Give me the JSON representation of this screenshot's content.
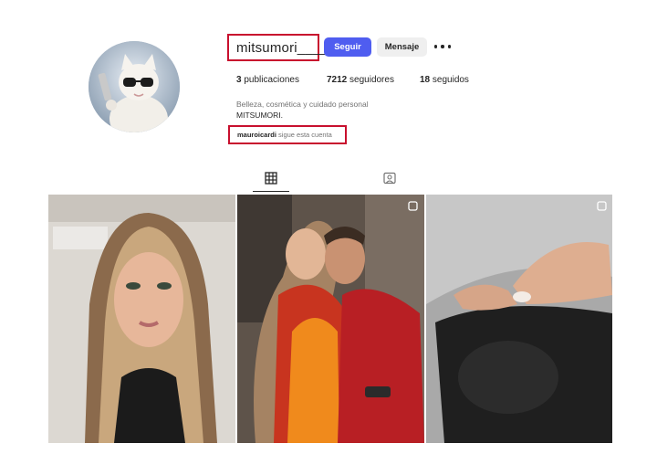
{
  "profile": {
    "username": "mitsumori____",
    "follow_label": "Seguir",
    "message_label": "Mensaje",
    "more_icon": "more-horizontal-icon"
  },
  "stats": {
    "posts_count": "3",
    "posts_label": "publicaciones",
    "followers_count": "7212",
    "followers_label": "seguidores",
    "following_count": "18",
    "following_label": "seguidos"
  },
  "bio": {
    "category": "Belleza, cosmética y cuidado personal",
    "name": "MITSUMORI."
  },
  "followed_by": {
    "user": "mauroicardi",
    "text": "sigue esta cuenta"
  },
  "tabs": {
    "posts_icon": "grid-icon",
    "tagged_icon": "tagged-user-icon"
  },
  "posts": [
    {
      "icon": "photo"
    },
    {
      "icon": "carousel-icon"
    },
    {
      "icon": "carousel-icon"
    }
  ],
  "colors": {
    "highlight_border": "#c8102e",
    "follow_button": "#4f5df0",
    "message_button": "#efefef"
  }
}
